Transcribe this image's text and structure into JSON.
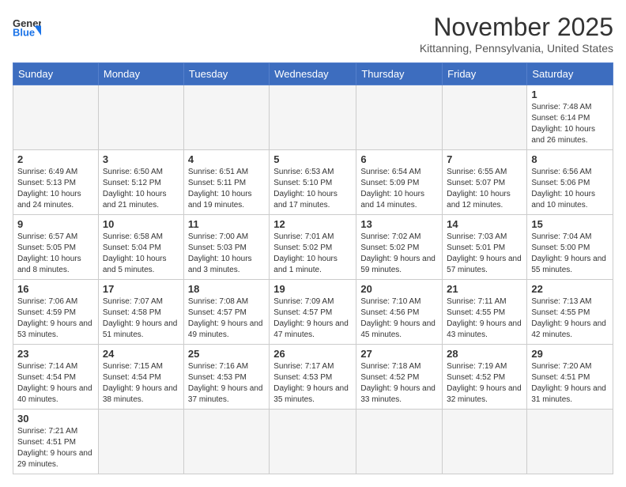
{
  "logo": {
    "general": "General",
    "blue": "Blue"
  },
  "header": {
    "month": "November 2025",
    "location": "Kittanning, Pennsylvania, United States"
  },
  "weekdays": [
    "Sunday",
    "Monday",
    "Tuesday",
    "Wednesday",
    "Thursday",
    "Friday",
    "Saturday"
  ],
  "weeks": [
    [
      {
        "day": "",
        "info": ""
      },
      {
        "day": "",
        "info": ""
      },
      {
        "day": "",
        "info": ""
      },
      {
        "day": "",
        "info": ""
      },
      {
        "day": "",
        "info": ""
      },
      {
        "day": "",
        "info": ""
      },
      {
        "day": "1",
        "info": "Sunrise: 7:48 AM\nSunset: 6:14 PM\nDaylight: 10 hours and 26 minutes."
      }
    ],
    [
      {
        "day": "2",
        "info": "Sunrise: 6:49 AM\nSunset: 5:13 PM\nDaylight: 10 hours and 24 minutes."
      },
      {
        "day": "3",
        "info": "Sunrise: 6:50 AM\nSunset: 5:12 PM\nDaylight: 10 hours and 21 minutes."
      },
      {
        "day": "4",
        "info": "Sunrise: 6:51 AM\nSunset: 5:11 PM\nDaylight: 10 hours and 19 minutes."
      },
      {
        "day": "5",
        "info": "Sunrise: 6:53 AM\nSunset: 5:10 PM\nDaylight: 10 hours and 17 minutes."
      },
      {
        "day": "6",
        "info": "Sunrise: 6:54 AM\nSunset: 5:09 PM\nDaylight: 10 hours and 14 minutes."
      },
      {
        "day": "7",
        "info": "Sunrise: 6:55 AM\nSunset: 5:07 PM\nDaylight: 10 hours and 12 minutes."
      },
      {
        "day": "8",
        "info": "Sunrise: 6:56 AM\nSunset: 5:06 PM\nDaylight: 10 hours and 10 minutes."
      }
    ],
    [
      {
        "day": "9",
        "info": "Sunrise: 6:57 AM\nSunset: 5:05 PM\nDaylight: 10 hours and 8 minutes."
      },
      {
        "day": "10",
        "info": "Sunrise: 6:58 AM\nSunset: 5:04 PM\nDaylight: 10 hours and 5 minutes."
      },
      {
        "day": "11",
        "info": "Sunrise: 7:00 AM\nSunset: 5:03 PM\nDaylight: 10 hours and 3 minutes."
      },
      {
        "day": "12",
        "info": "Sunrise: 7:01 AM\nSunset: 5:02 PM\nDaylight: 10 hours and 1 minute."
      },
      {
        "day": "13",
        "info": "Sunrise: 7:02 AM\nSunset: 5:02 PM\nDaylight: 9 hours and 59 minutes."
      },
      {
        "day": "14",
        "info": "Sunrise: 7:03 AM\nSunset: 5:01 PM\nDaylight: 9 hours and 57 minutes."
      },
      {
        "day": "15",
        "info": "Sunrise: 7:04 AM\nSunset: 5:00 PM\nDaylight: 9 hours and 55 minutes."
      }
    ],
    [
      {
        "day": "16",
        "info": "Sunrise: 7:06 AM\nSunset: 4:59 PM\nDaylight: 9 hours and 53 minutes."
      },
      {
        "day": "17",
        "info": "Sunrise: 7:07 AM\nSunset: 4:58 PM\nDaylight: 9 hours and 51 minutes."
      },
      {
        "day": "18",
        "info": "Sunrise: 7:08 AM\nSunset: 4:57 PM\nDaylight: 9 hours and 49 minutes."
      },
      {
        "day": "19",
        "info": "Sunrise: 7:09 AM\nSunset: 4:57 PM\nDaylight: 9 hours and 47 minutes."
      },
      {
        "day": "20",
        "info": "Sunrise: 7:10 AM\nSunset: 4:56 PM\nDaylight: 9 hours and 45 minutes."
      },
      {
        "day": "21",
        "info": "Sunrise: 7:11 AM\nSunset: 4:55 PM\nDaylight: 9 hours and 43 minutes."
      },
      {
        "day": "22",
        "info": "Sunrise: 7:13 AM\nSunset: 4:55 PM\nDaylight: 9 hours and 42 minutes."
      }
    ],
    [
      {
        "day": "23",
        "info": "Sunrise: 7:14 AM\nSunset: 4:54 PM\nDaylight: 9 hours and 40 minutes."
      },
      {
        "day": "24",
        "info": "Sunrise: 7:15 AM\nSunset: 4:54 PM\nDaylight: 9 hours and 38 minutes."
      },
      {
        "day": "25",
        "info": "Sunrise: 7:16 AM\nSunset: 4:53 PM\nDaylight: 9 hours and 37 minutes."
      },
      {
        "day": "26",
        "info": "Sunrise: 7:17 AM\nSunset: 4:53 PM\nDaylight: 9 hours and 35 minutes."
      },
      {
        "day": "27",
        "info": "Sunrise: 7:18 AM\nSunset: 4:52 PM\nDaylight: 9 hours and 33 minutes."
      },
      {
        "day": "28",
        "info": "Sunrise: 7:19 AM\nSunset: 4:52 PM\nDaylight: 9 hours and 32 minutes."
      },
      {
        "day": "29",
        "info": "Sunrise: 7:20 AM\nSunset: 4:51 PM\nDaylight: 9 hours and 31 minutes."
      }
    ],
    [
      {
        "day": "30",
        "info": "Sunrise: 7:21 AM\nSunset: 4:51 PM\nDaylight: 9 hours and 29 minutes."
      },
      {
        "day": "",
        "info": ""
      },
      {
        "day": "",
        "info": ""
      },
      {
        "day": "",
        "info": ""
      },
      {
        "day": "",
        "info": ""
      },
      {
        "day": "",
        "info": ""
      },
      {
        "day": "",
        "info": ""
      }
    ]
  ]
}
